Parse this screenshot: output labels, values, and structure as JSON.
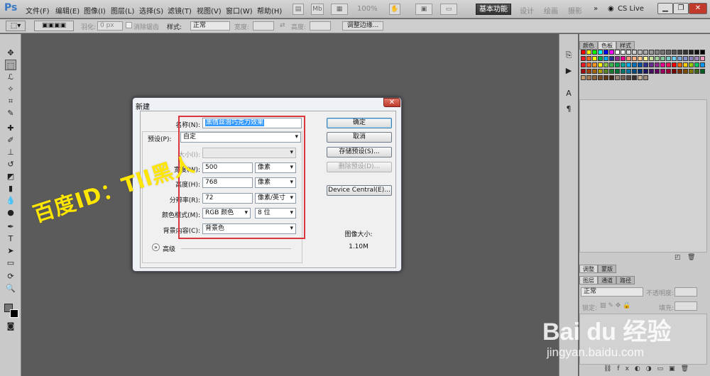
{
  "app": {
    "logo": "Ps"
  },
  "menu": [
    "文件(F)",
    "编辑(E)",
    "图像(I)",
    "图层(L)",
    "选择(S)",
    "滤镜(T)",
    "视图(V)",
    "窗口(W)",
    "帮助(H)"
  ],
  "toolbar_top": {
    "zoom": "100%",
    "mb": "Mb",
    "workspace_active": "基本功能",
    "workspaces": [
      "设计",
      "绘画",
      "摄影"
    ],
    "more": "»",
    "cs_live": "CS Live"
  },
  "options": {
    "feather_label": "羽化:",
    "feather_value": "0 px",
    "antialias": "消除锯齿",
    "style_label": "样式:",
    "style_value": "正常",
    "width_label": "宽度:",
    "height_label": "高度:",
    "refine_edge": "调整边缘..."
  },
  "dialog": {
    "title": "新建",
    "close": "✕",
    "name_label": "名称(N):",
    "name_value": "黑情丝滑巧克力效果",
    "preset_label": "预设(P):",
    "preset_value": "自定",
    "size_label": "大小(I):",
    "width_label": "宽度(W):",
    "width_value": "500",
    "width_unit": "像素",
    "height_label": "高度(H):",
    "height_value": "768",
    "height_unit": "像素",
    "resolution_label": "分辨率(R):",
    "resolution_value": "72",
    "resolution_unit": "像素/英寸",
    "mode_label": "颜色模式(M):",
    "mode_value": "RGB 颜色",
    "bit_value": "8 位",
    "bg_label": "背景内容(C):",
    "bg_value": "背景色",
    "advanced": "高级",
    "ok": "确定",
    "cancel": "取消",
    "save_preset": "存储预设(S)...",
    "delete_preset": "删除预设(D)...",
    "device_central": "Device Central(E)...",
    "image_size_label": "图像大小:",
    "image_size_value": "1.10M"
  },
  "panels": {
    "tabs_top": [
      "颜色",
      "色板",
      "样式"
    ],
    "tabs_mid": [
      "调整",
      "蒙版"
    ],
    "tabs_layers": [
      "图层",
      "通道",
      "路径"
    ],
    "blend_mode": "正常",
    "opacity_label": "不透明度:",
    "lock_label": "锁定:",
    "fill_label": "填充:"
  },
  "watermarks": {
    "text": "百度ID：Tll黑人",
    "logo": "Bai du 经验",
    "url": "jingyan.baidu.com"
  },
  "colors": {
    "accent_red": "#d9363e",
    "selection_blue": "#3399ff",
    "watermark_yellow": "#ffe600"
  }
}
